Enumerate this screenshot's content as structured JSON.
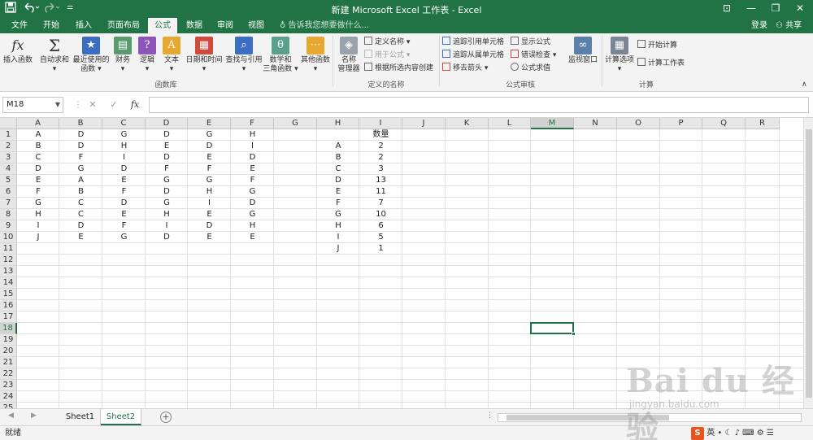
{
  "window": {
    "title": "新建 Microsoft Excel 工作表 - Excel",
    "save_icon": "save-icon",
    "undo_icon": "undo-icon",
    "redo_icon": "redo-icon",
    "minimize": "—",
    "restore": "❐",
    "close": "✕"
  },
  "tabs": [
    "文件",
    "开始",
    "插入",
    "页面布局",
    "公式",
    "数据",
    "审阅",
    "视图"
  ],
  "active_tab": "公式",
  "tell_me": "告诉我您想要做什么...",
  "login": "登录",
  "share": "共享",
  "ribbon": {
    "insert_fn": "插入函数",
    "autosum": [
      "自动求和",
      "▾"
    ],
    "recent": [
      "最近使用的",
      "函数 ▾"
    ],
    "financial": [
      "财务",
      "▾"
    ],
    "logical": [
      "逻辑",
      "▾"
    ],
    "text": [
      "文本",
      "▾"
    ],
    "datetime": [
      "日期和时间",
      "▾"
    ],
    "lookup": [
      "查找与引用",
      "▾"
    ],
    "math": [
      "数学和",
      "三角函数 ▾"
    ],
    "other": [
      "其他函数",
      "▾"
    ],
    "group_library": "函数库",
    "name_manager": [
      "名称",
      "管理器"
    ],
    "define_name": "定义名称 ▾",
    "use_in_formula": "用于公式 ▾",
    "create_from_sel": "根据所选内容创建",
    "group_names": "定义的名称",
    "trace_precedents": "追踪引用单元格",
    "trace_dependents": "追踪从属单元格",
    "remove_arrows": "移去箭头 ▾",
    "show_formulas": "显示公式",
    "error_checking": "错误检查 ▾",
    "evaluate": "公式求值",
    "watch_window": "监视窗口",
    "group_audit": "公式审核",
    "calc_options": [
      "计算选项",
      "▾"
    ],
    "calc_now": "开始计算",
    "calc_sheet": "计算工作表",
    "group_calc": "计算",
    "fx_glyph": "fx",
    "sigma_glyph": "Σ"
  },
  "formula_bar": {
    "name_box": "M18",
    "cancel": "✕",
    "enter": "✓",
    "fx": "fx",
    "formula": ""
  },
  "columns": [
    "A",
    "B",
    "C",
    "D",
    "E",
    "F",
    "G",
    "H",
    "I",
    "J",
    "K",
    "L",
    "M",
    "N",
    "O",
    "P",
    "Q",
    "R"
  ],
  "rows": [
    "1",
    "2",
    "3",
    "4",
    "5",
    "6",
    "7",
    "8",
    "9",
    "10",
    "11",
    "12",
    "13",
    "14",
    "15",
    "16",
    "17",
    "18",
    "19",
    "20",
    "21",
    "22",
    "23",
    "24",
    "25"
  ],
  "selected_cell": "M18",
  "table_main": [
    [
      "A",
      "D",
      "G",
      "D",
      "G",
      "H"
    ],
    [
      "B",
      "D",
      "H",
      "E",
      "D",
      "I"
    ],
    [
      "C",
      "F",
      "I",
      "D",
      "E",
      "D"
    ],
    [
      "D",
      "G",
      "D",
      "F",
      "F",
      "E"
    ],
    [
      "E",
      "A",
      "E",
      "G",
      "G",
      "F"
    ],
    [
      "F",
      "B",
      "F",
      "D",
      "H",
      "G"
    ],
    [
      "G",
      "C",
      "D",
      "G",
      "I",
      "D"
    ],
    [
      "H",
      "C",
      "E",
      "H",
      "E",
      "G"
    ],
    [
      "I",
      "D",
      "F",
      "I",
      "D",
      "H"
    ],
    [
      "J",
      "E",
      "G",
      "D",
      "E",
      "E"
    ]
  ],
  "count_header": "数量",
  "counts": [
    [
      "A",
      "2"
    ],
    [
      "B",
      "2"
    ],
    [
      "C",
      "3"
    ],
    [
      "D",
      "13"
    ],
    [
      "E",
      "11"
    ],
    [
      "F",
      "7"
    ],
    [
      "G",
      "10"
    ],
    [
      "H",
      "6"
    ],
    [
      "I",
      "5"
    ],
    [
      "J",
      "1"
    ]
  ],
  "sheets": [
    "Sheet1",
    "Sheet2"
  ],
  "active_sheet": "Sheet2",
  "status": "就绪",
  "ime": {
    "logo": "S",
    "lang": "英",
    "icons": "• ☾ ♪ ⌨ ⚙ ☰"
  },
  "watermark": {
    "brand": "Bai du 经验",
    "url": "jingyan.baidu.com"
  }
}
